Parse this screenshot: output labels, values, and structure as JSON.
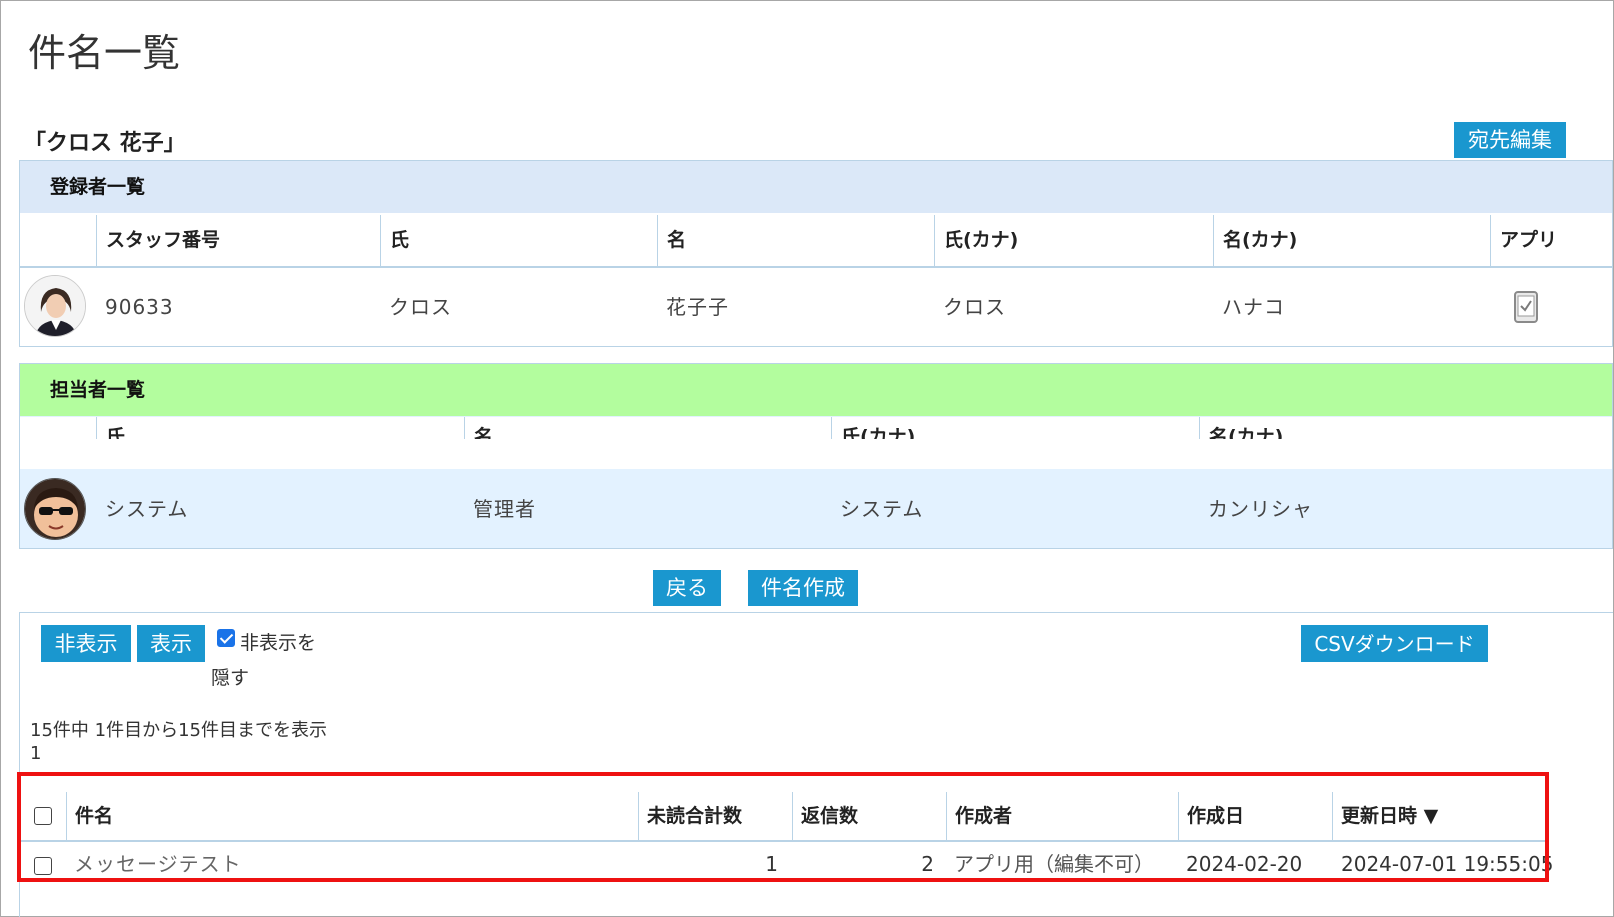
{
  "page": {
    "title": "件名一覧",
    "person_heading": "「クロス 花子」"
  },
  "buttons": {
    "edit_recipients": "宛先編集",
    "back": "戻る",
    "create_subject": "件名作成",
    "hide": "非表示",
    "show": "表示",
    "csv_download": "CSVダウンロード"
  },
  "registrants": {
    "heading": "登録者一覧",
    "header_color": "#dbe8f8",
    "columns": [
      "スタッフ番号",
      "氏",
      "名",
      "氏(カナ)",
      "名(カナ)",
      "アプリ"
    ],
    "rows": [
      {
        "staff_no": "90633",
        "last": "クロス",
        "first": "花子子",
        "last_kana": "クロス",
        "first_kana": "ハナコ",
        "app_icon": "phone-check-icon"
      }
    ]
  },
  "staff": {
    "heading": "担当者一覧",
    "header_color": "#b3fd9e",
    "columns": [
      "氏",
      "名",
      "氏(カナ)",
      "名(カナ)"
    ],
    "rows": [
      {
        "last": "システム",
        "first": "管理者",
        "last_kana": "システム",
        "first_kana": "カンリシャ"
      }
    ]
  },
  "filter": {
    "hide_hidden_label_1": "非表示を",
    "hide_hidden_label_2": "隠す",
    "hide_hidden_checked": true
  },
  "pagination": {
    "summary": "15件中 1件目から15件目までを表示",
    "page": "1"
  },
  "subjects": {
    "columns": [
      "件名",
      "未読合計数",
      "返信数",
      "作成者",
      "作成日",
      "更新日時 ▼"
    ],
    "rows": [
      {
        "subject": "メッセージテスト",
        "unread": "1",
        "replies": "2",
        "author": "アプリ用（編集不可）",
        "created": "2024-02-20",
        "updated": "2024-07-01 19:55:05"
      }
    ]
  },
  "colors": {
    "accent": "#1a97cf",
    "highlight": "#ee1111",
    "border": "#b9d3e6"
  }
}
